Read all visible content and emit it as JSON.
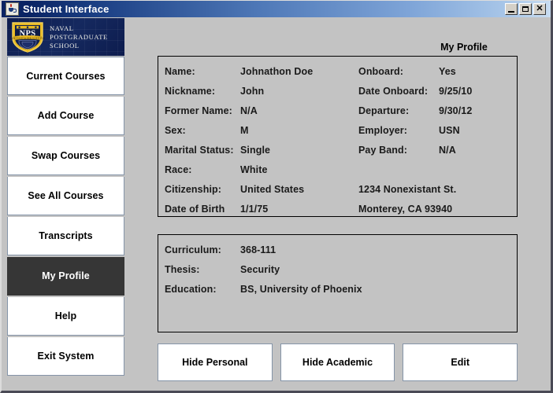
{
  "window": {
    "title": "Student Interface",
    "app_icon": "java-coffee-cup-icon",
    "controls": {
      "minimize": "_",
      "maximize": "□",
      "close": "✕"
    }
  },
  "branding": {
    "shield_text": "NPS",
    "shield_motto": "PRAESTANTIA PER SCIENTIAM",
    "line1": "NAVAL",
    "line2": "POSTGRADUATE",
    "line3": "SCHOOL",
    "colors": {
      "navy": "#0d1c4e",
      "gold": "#e8b923"
    }
  },
  "sidebar": {
    "items": [
      {
        "label": "Current Courses",
        "selected": false
      },
      {
        "label": "Add Course",
        "selected": false
      },
      {
        "label": "Swap Courses",
        "selected": false
      },
      {
        "label": "See All Courses",
        "selected": false
      },
      {
        "label": "Transcripts",
        "selected": false
      },
      {
        "label": "My Profile",
        "selected": true
      },
      {
        "label": "Help",
        "selected": false
      },
      {
        "label": "Exit System",
        "selected": false
      }
    ],
    "selected_bg": "#363636"
  },
  "main": {
    "heading": "My Profile",
    "personal": {
      "rows": [
        {
          "label": "Name:",
          "value": "Johnathon Doe",
          "label2": "Onboard:",
          "value2": "Yes"
        },
        {
          "label": "Nickname:",
          "value": "John",
          "label2": "Date Onboard:",
          "value2": "9/25/10"
        },
        {
          "label": "Former Name:",
          "value": "N/A",
          "label2": "Departure:",
          "value2": "9/30/12"
        },
        {
          "label": "Sex:",
          "value": "M",
          "label2": "Employer:",
          "value2": "USN"
        },
        {
          "label": "Marital Status:",
          "value": "Single",
          "label2": "Pay Band:",
          "value2": "N/A"
        },
        {
          "label": "Race:",
          "value": "White",
          "label2": "",
          "value2": ""
        },
        {
          "label": "Citizenship:",
          "value": "United States",
          "span2": "1234 Nonexistant St."
        },
        {
          "label": "Date of Birth",
          "value": "1/1/75",
          "span2": "Monterey, CA 93940"
        }
      ]
    },
    "academic": {
      "rows": [
        {
          "label": "Curriculum:",
          "value": "368-111"
        },
        {
          "label": "Thesis:",
          "value": "Security"
        },
        {
          "label": "Education:",
          "value": "BS, University of Phoenix"
        }
      ]
    },
    "buttons": [
      {
        "label": "Hide Personal"
      },
      {
        "label": "Hide Academic"
      },
      {
        "label": "Edit"
      }
    ]
  }
}
